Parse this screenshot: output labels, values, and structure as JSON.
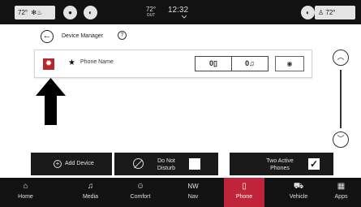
{
  "status_bar": {
    "left_temp": "72°",
    "left_icons": "fan-icon",
    "outside_temp": "72°",
    "outside_label": "OUT",
    "time": "12:32",
    "right_temp": "72°"
  },
  "header": {
    "title": "Device Manager",
    "help_symbol": "?"
  },
  "device": {
    "name": "Phone Name",
    "phone_symbol": "0▯",
    "audio_symbol": "0♫",
    "details_symbol": "◉"
  },
  "actions": {
    "add_device": "Add Device",
    "do_not_disturb": "Do Not Disturb",
    "do_not_disturb_checked": false,
    "two_active_phones": "Two Active Phones",
    "two_active_phones_checked": true
  },
  "nav": {
    "items": [
      {
        "label": "Home",
        "icon": "home-icon",
        "glyph": "⌂"
      },
      {
        "label": "Media",
        "icon": "music-note-icon",
        "glyph": "♫"
      },
      {
        "label": "Comfort",
        "icon": "comfort-icon",
        "glyph": "☺"
      },
      {
        "label": "Nav",
        "icon": "compass-icon",
        "glyph": "NW"
      },
      {
        "label": "Phone",
        "icon": "phone-icon",
        "glyph": "▯"
      },
      {
        "label": "Vehicle",
        "icon": "car-icon",
        "glyph": "⛟"
      },
      {
        "label": "Apps",
        "icon": "grid-icon",
        "glyph": "▦"
      }
    ],
    "active": "Phone"
  },
  "colors": {
    "accent": "#c0243a",
    "gear": "#b8262e",
    "bar": "#121212"
  }
}
